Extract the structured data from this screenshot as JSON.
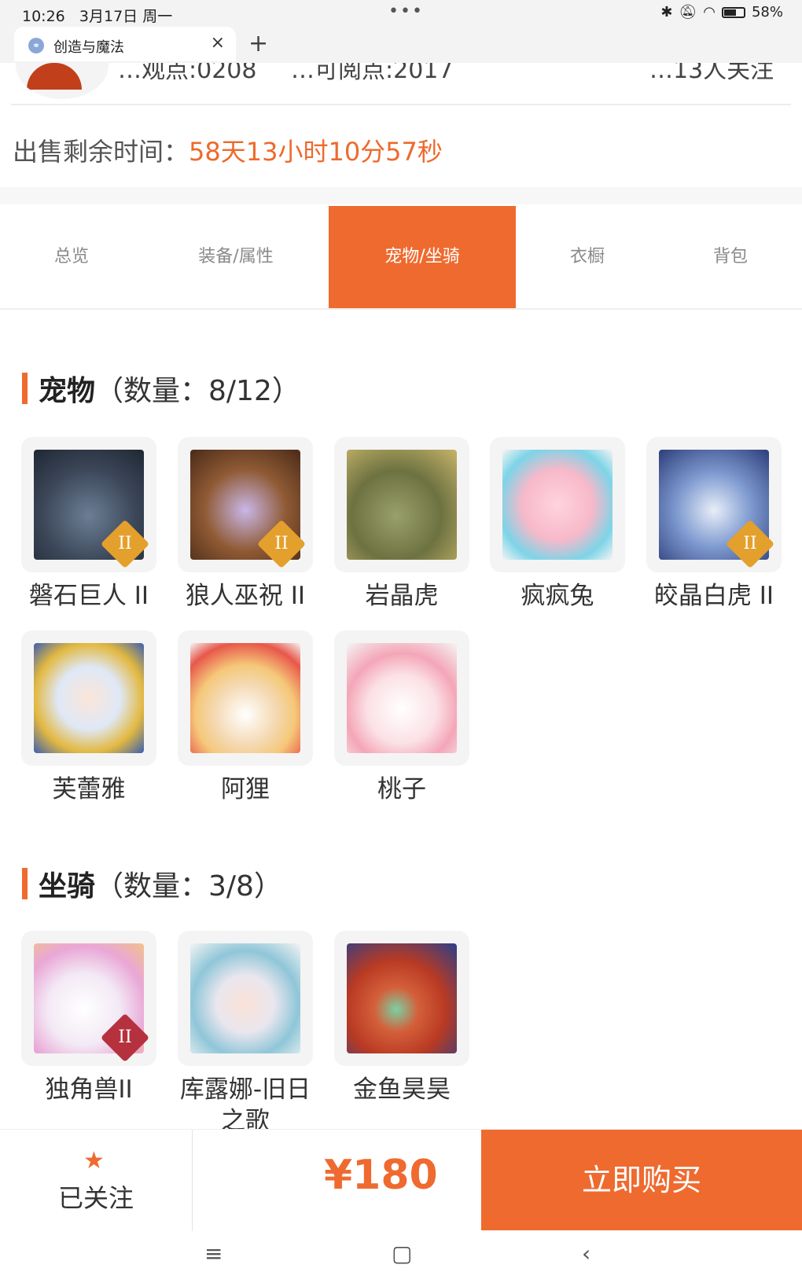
{
  "status_bar": {
    "time": "10:26",
    "date": "3月17日 周一",
    "battery": "58%",
    "battery_level": 0.58,
    "icons": [
      "bluetooth-icon",
      "mute-icon",
      "wifi-icon",
      "battery-icon"
    ]
  },
  "browser": {
    "tab_title": "创造与魔法",
    "close_glyph": "×",
    "new_tab_glyph": "+"
  },
  "header_cut": {
    "stat1": "…观点:0208",
    "stat2": "…可阅点:2017",
    "stat3": "…13人关注"
  },
  "sale": {
    "label": "出售剩余时间：",
    "remaining": "58天13小时10分57秒"
  },
  "tabs": [
    {
      "label": "总览",
      "active": false
    },
    {
      "label": "装备/属性",
      "active": false
    },
    {
      "label": "宠物/坐骑",
      "active": true
    },
    {
      "label": "衣橱",
      "active": false
    },
    {
      "label": "背包",
      "active": false
    }
  ],
  "pets": {
    "title": "宠物",
    "count": "（数量：8/12）",
    "items": [
      {
        "name": "磐石巨人 II",
        "badge": "II",
        "icon": "stone-giant-icon"
      },
      {
        "name": "狼人巫祝 II",
        "badge": "II",
        "icon": "werewolf-shaman-icon"
      },
      {
        "name": "岩晶虎",
        "badge": "",
        "icon": "rock-tiger-icon"
      },
      {
        "name": "疯疯兔",
        "badge": "",
        "icon": "crazy-rabbit-icon"
      },
      {
        "name": "皎晶白虎 II",
        "badge": "II",
        "icon": "white-tiger-icon"
      },
      {
        "name": "芙蕾雅",
        "badge": "",
        "icon": "freya-icon"
      },
      {
        "name": "阿狸",
        "badge": "",
        "icon": "ali-icon"
      },
      {
        "name": "桃子",
        "badge": "",
        "icon": "peach-icon"
      }
    ]
  },
  "mounts": {
    "title": "坐骑",
    "count": "（数量：3/8）",
    "items": [
      {
        "name": "独角兽II",
        "badge": "II",
        "icon": "unicorn-icon"
      },
      {
        "name": "库露娜-旧日之歌",
        "badge": "",
        "icon": "kuluna-icon"
      },
      {
        "name": "金鱼昊昊",
        "badge": "",
        "icon": "goldfish-icon"
      }
    ]
  },
  "bottom": {
    "follow_label": "已关注",
    "price": "¥180",
    "buy_label": "立即购买"
  },
  "nav": {
    "menu": "≡",
    "home": "▢",
    "back": "‹"
  },
  "colors": {
    "accent": "#ef6a2f"
  }
}
